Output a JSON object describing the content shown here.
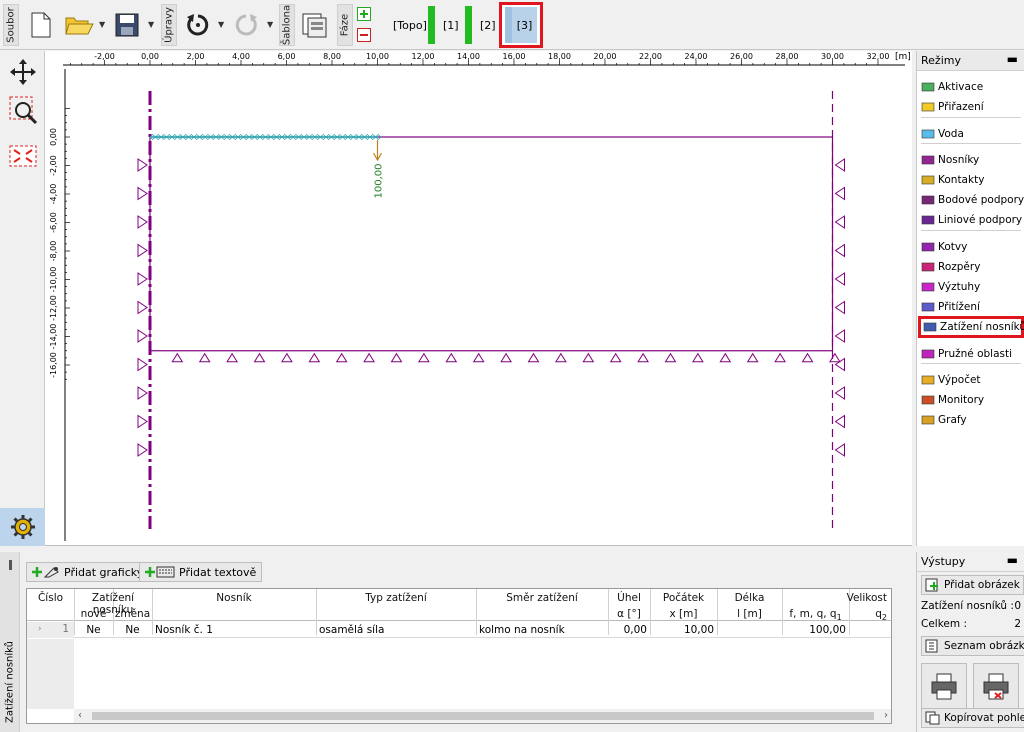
{
  "toolbar": {
    "file_label": "Soubor",
    "edit_label": "Úpravy",
    "template_label": "Šablona",
    "phase_label": "Fáze",
    "stages": [
      "[Topo]",
      "[1]",
      "[2]",
      "[3]"
    ]
  },
  "canvas": {
    "unit": "[m]",
    "x_ticks": [
      "-2,00",
      "0,00",
      "2,00",
      "4,00",
      "6,00",
      "8,00",
      "10,00",
      "12,00",
      "14,00",
      "16,00",
      "18,00",
      "20,00",
      "22,00",
      "24,00",
      "26,00",
      "28,00",
      "30,00",
      "32,00"
    ],
    "y_ticks": [
      "0,00",
      "-2,00",
      "-4,00",
      "-6,00",
      "-8,00",
      "-10,00",
      "-12,00",
      "-14,00",
      "-16,00"
    ],
    "load_label": "100,00",
    "colors": {
      "geometry": "#800080",
      "load": "#c08020",
      "load_text": "#208020",
      "beam": "#2aa6b0"
    }
  },
  "modes": {
    "title": "Režimy",
    "items": [
      {
        "label": "Aktivace",
        "icon": "activation-icon"
      },
      {
        "label": "Přiřazení",
        "icon": "assignment-icon"
      },
      {
        "label": "Voda",
        "icon": "water-icon"
      },
      {
        "label": "Nosníky",
        "icon": "beams-icon"
      },
      {
        "label": "Kontakty",
        "icon": "contacts-icon"
      },
      {
        "label": "Bodové podpory",
        "icon": "point-supports-icon"
      },
      {
        "label": "Liniové podpory",
        "icon": "line-supports-icon"
      },
      {
        "label": "Kotvy",
        "icon": "anchors-icon"
      },
      {
        "label": "Rozpěry",
        "icon": "struts-icon"
      },
      {
        "label": "Výztuhy",
        "icon": "reinforcements-icon"
      },
      {
        "label": "Přitížení",
        "icon": "surcharge-icon"
      },
      {
        "label": "Zatížení nosníků",
        "icon": "beam-loads-icon"
      },
      {
        "label": "Pružné oblasti",
        "icon": "elastic-regions-icon"
      },
      {
        "label": "Výpočet",
        "icon": "analysis-icon"
      },
      {
        "label": "Monitory",
        "icon": "monitors-icon"
      },
      {
        "label": "Grafy",
        "icon": "graphs-icon"
      }
    ]
  },
  "bottom": {
    "side_label": "Zatížení nosníků",
    "add_graphic": "Přidat graficky",
    "add_text": "Přidat textově",
    "table": {
      "headers": {
        "cislo": "Číslo",
        "zatizeni_nosniku": "Zatížení nosníku",
        "nove": "nové",
        "zmena": "změna",
        "nosnik": "Nosník",
        "typ": "Typ zatížení",
        "smer": "Směr zatížení",
        "uhel": "Úhel",
        "uhel_unit": "α [°]",
        "pocatek": "Počátek",
        "pocatek_unit": "x [m]",
        "delka": "Délka",
        "delka_unit": "l [m]",
        "velikost": "Velikost",
        "velikost_unit": "f, m, q, q",
        "velikost_sub": "1",
        "q2": "q",
        "q2_sub": "2"
      },
      "rows": [
        {
          "num": "1",
          "nove": "Ne",
          "zmena": "Ne",
          "nosnik": "Nosník č. 1",
          "typ": "osamělá síla",
          "smer": "kolmo na nosník",
          "uhel": "0,00",
          "pocatek": "10,00",
          "delka": "",
          "velikost": "100,00",
          "q2": ""
        }
      ]
    }
  },
  "outputs": {
    "title": "Výstupy",
    "add_picture": "Přidat obrázek",
    "beam_loads_label": "Zatížení nosníků :",
    "beam_loads_value": "0",
    "total_label": "Celkem :",
    "total_value": "2",
    "picture_list": "Seznam obrázků",
    "copy_view": "Kopírovat pohled"
  }
}
